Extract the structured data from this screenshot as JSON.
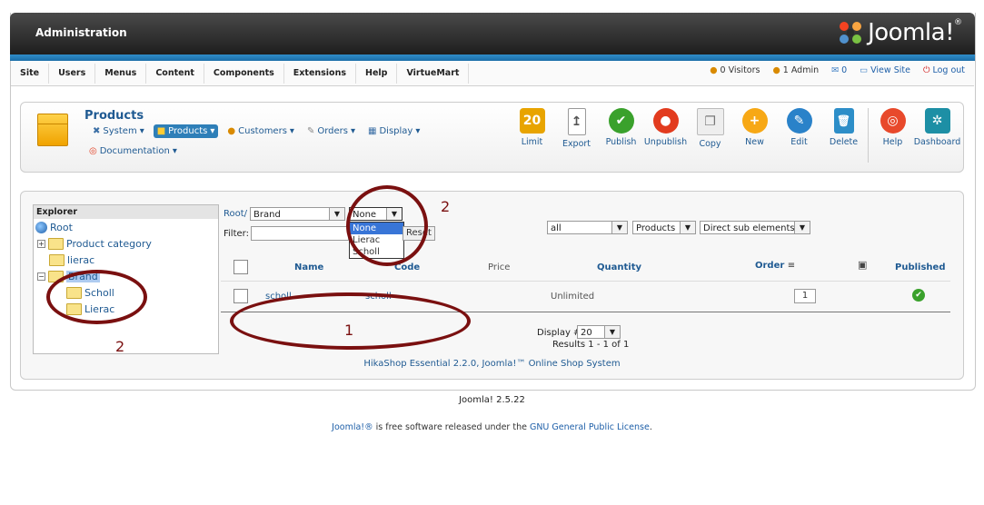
{
  "header": {
    "title": "Administration",
    "logo_text": "Joomla!",
    "logo_mark": "®"
  },
  "menu": {
    "items": [
      "Site",
      "Users",
      "Menus",
      "Content",
      "Components",
      "Extensions",
      "Help",
      "VirtueMart"
    ]
  },
  "status": {
    "visitors": "0 Visitors",
    "admins": "1 Admin",
    "messages": "0",
    "view_site": "View Site",
    "logout": "Log out"
  },
  "toolbar": {
    "page_title": "Products",
    "submenu": [
      {
        "label": "System"
      },
      {
        "label": "Products"
      },
      {
        "label": "Customers"
      },
      {
        "label": "Orders"
      },
      {
        "label": "Display"
      }
    ],
    "documentation": "Documentation",
    "buttons": [
      {
        "label": "Limit",
        "icon": "calendar-icon",
        "color": "#e8a400",
        "glyph": "20"
      },
      {
        "label": "Export",
        "icon": "export-icon",
        "color": "#9a9a9a",
        "glyph": "↥"
      },
      {
        "label": "Publish",
        "icon": "publish-icon",
        "color": "#3aa12c",
        "glyph": "✔"
      },
      {
        "label": "Unpublish",
        "icon": "unpublish-icon",
        "color": "#e23b1e",
        "glyph": "●"
      },
      {
        "label": "Copy",
        "icon": "copy-icon",
        "color": "#bdbdbd",
        "glyph": "❐"
      },
      {
        "label": "New",
        "icon": "new-icon",
        "color": "#f7a815",
        "glyph": "+"
      },
      {
        "label": "Edit",
        "icon": "edit-icon",
        "color": "#2a82c9",
        "glyph": "✎"
      },
      {
        "label": "Delete",
        "icon": "delete-icon",
        "color": "#2d8ec8",
        "glyph": "🗑"
      },
      {
        "label": "Help",
        "icon": "help-icon",
        "color": "#e8492b",
        "glyph": "◎"
      },
      {
        "label": "Dashboard",
        "icon": "dashboard-icon",
        "color": "#1d8fa5",
        "glyph": "✲"
      }
    ]
  },
  "explorer": {
    "header": "Explorer",
    "root": "Root",
    "items": [
      "Product category",
      "lierac",
      "Brand",
      "Scholl",
      "Lierac"
    ]
  },
  "filters": {
    "breadcrumb_root": "Root/",
    "category": "Brand",
    "brand_select": "None",
    "brand_options": [
      "None",
      "Lierac",
      "Scholl"
    ],
    "filter_label": "Filter:",
    "reset": "Reset",
    "all": "all",
    "type": "Products",
    "depth": "Direct sub elements"
  },
  "table": {
    "headers": {
      "name": "Name",
      "code": "Code",
      "price": "Price",
      "quantity": "Quantity",
      "order": "Order",
      "published": "Published"
    },
    "rows": [
      {
        "name": "scholl",
        "code": "scholl",
        "quantity": "Unlimited",
        "order": "1"
      }
    ],
    "display_label": "Display #",
    "display_value": "20",
    "results": "Results 1 - 1 of 1",
    "credit": "HikaShop Essential 2.2.0, Joomla!™ Online Shop System"
  },
  "annotations": {
    "one": "1",
    "two_a": "2",
    "two_b": "2"
  },
  "footer": {
    "version": "Joomla! 2.5.22",
    "license_pre": "Joomla!®",
    "license_mid": " is free software released under the ",
    "license_link": "GNU General Public License",
    "license_end": "."
  }
}
